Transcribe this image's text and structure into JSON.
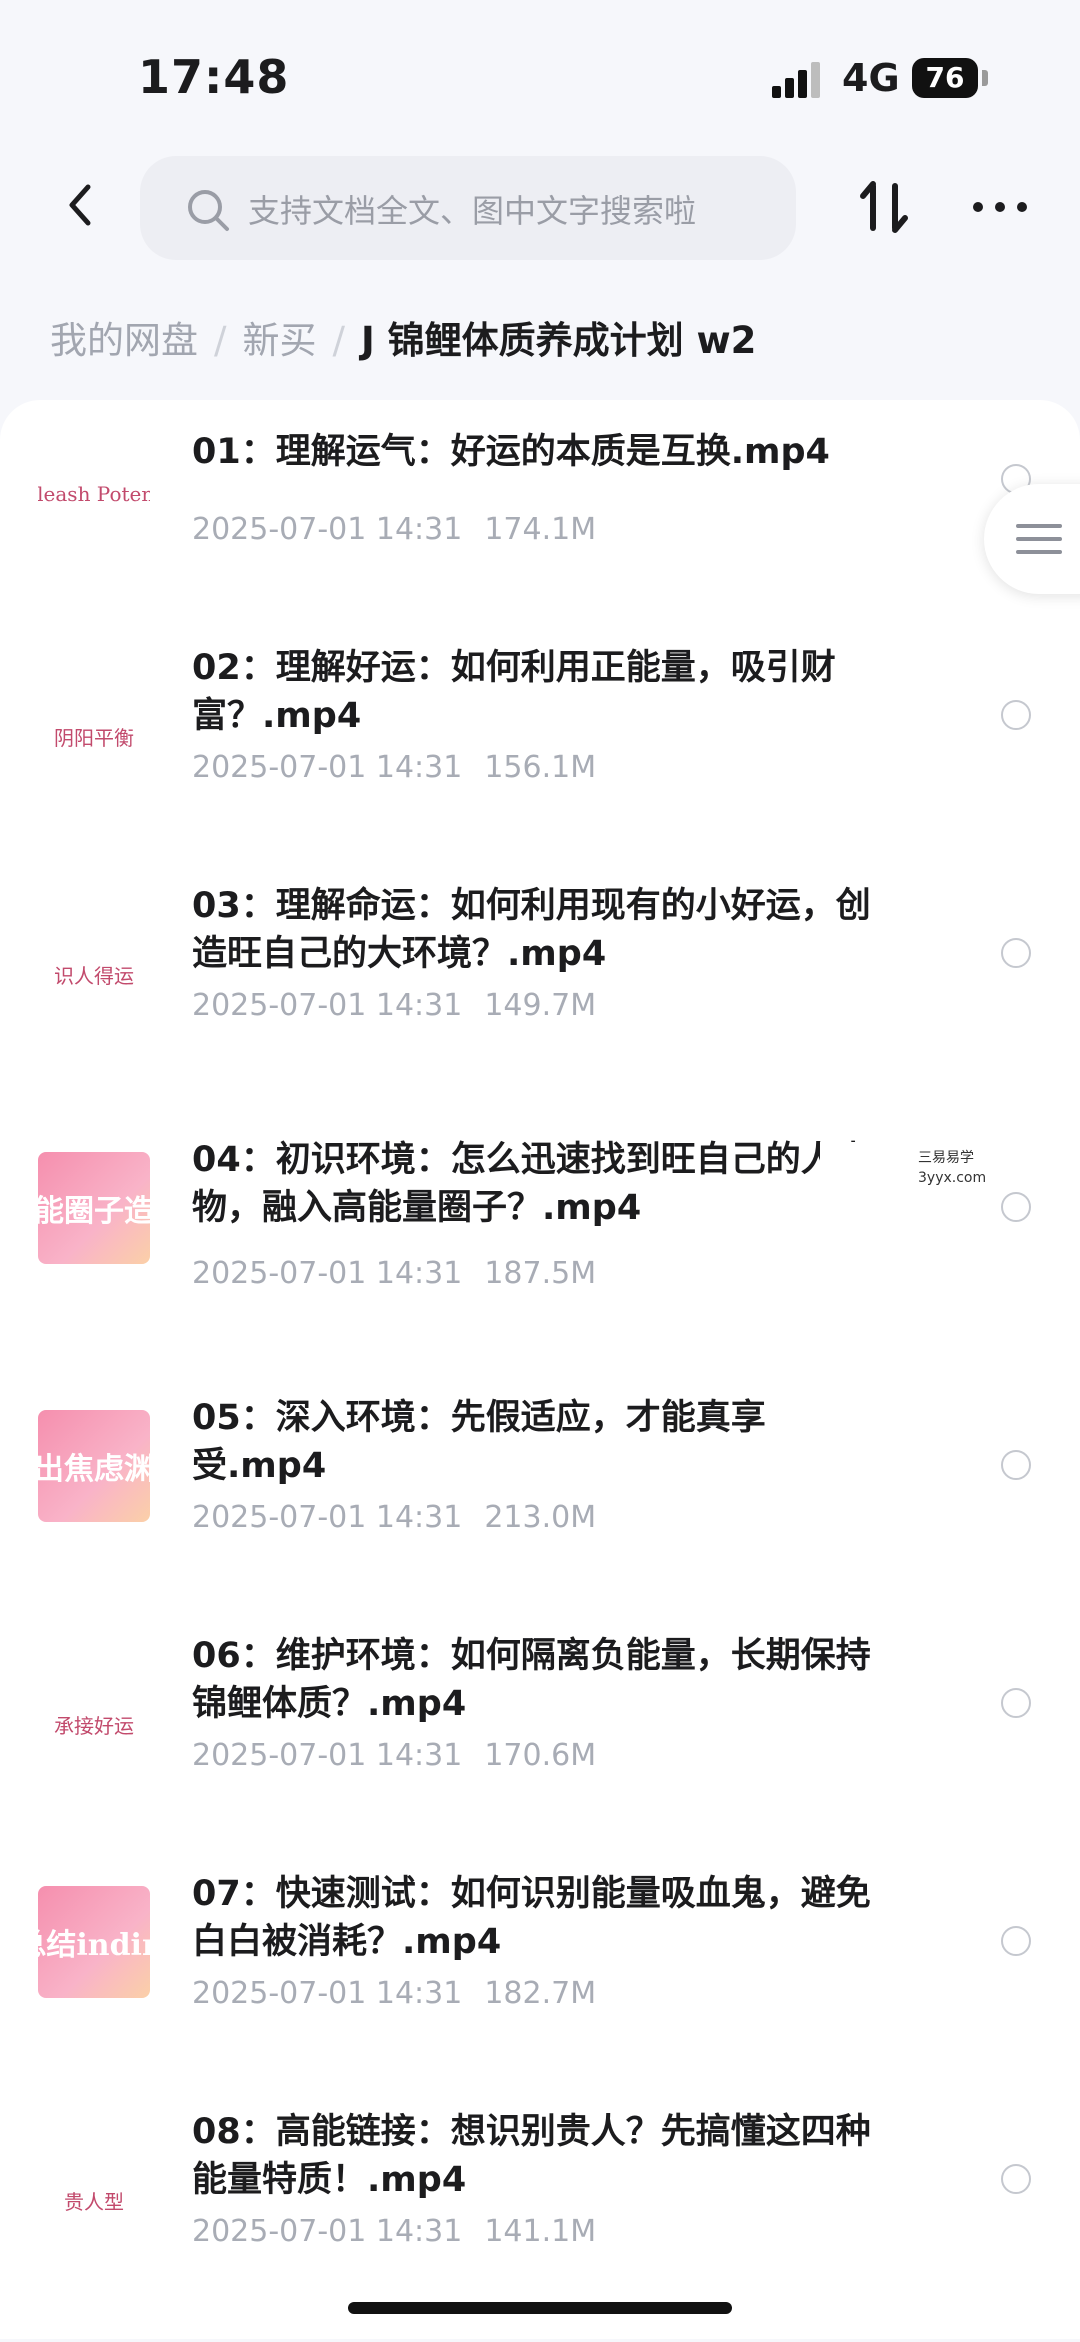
{
  "status_bar": {
    "time": "17:48",
    "network": "4G",
    "battery": "76"
  },
  "search": {
    "placeholder": "支持文档全文、图中文字搜索啦"
  },
  "breadcrumb": {
    "root": "我的网盘",
    "folder": "新买",
    "current": "J 锦鲤体质养成计划 w2",
    "separator": "/"
  },
  "watermark": {
    "line1": "三易易学",
    "line2": "3yyx.com"
  },
  "files": [
    {
      "title": "01：理解运气：好运的本质是互换.mp4",
      "date": "2025-07-01 14:31",
      "size": "174.1M",
      "thumb_text": "Unleash Potentia",
      "thumb_style": "light"
    },
    {
      "title": "02：理解好运：如何利用正能量，吸引财富？.mp4",
      "date": "2025-07-01 14:31",
      "size": "156.1M",
      "thumb_text": "阴阳平衡",
      "thumb_style": "light"
    },
    {
      "title": "03：理解命运：如何利用现有的小好运，创造旺自己的大环境？.mp4",
      "date": "2025-07-01 14:31",
      "size": "149.7M",
      "thumb_text": "识人得运",
      "thumb_style": "light"
    },
    {
      "title": "04：初识环境：怎么迅速找到旺自己的人事物，融入高能量圈子？.mp4",
      "date": "2025-07-01 14:31",
      "size": "187.5M",
      "thumb_text": "能圈子造",
      "thumb_style": "pink"
    },
    {
      "title": "05：深入环境：先假适应，才能真享受.mp4",
      "date": "2025-07-01 14:31",
      "size": "213.0M",
      "thumb_text": "出焦虑渊",
      "thumb_style": "pink"
    },
    {
      "title": "06：维护环境：如何隔离负能量，长期保持锦鲤体质？.mp4",
      "date": "2025-07-01 14:31",
      "size": "170.6M",
      "thumb_text": "承接好运",
      "thumb_style": "light"
    },
    {
      "title": "07：快速测试：如何识别能量吸血鬼，避免白白被消耗？.mp4",
      "date": "2025-07-01 14:31",
      "size": "182.7M",
      "thumb_text": "现总结indings",
      "thumb_style": "pink"
    },
    {
      "title": "08：高能链接：想识别贵人？先搞懂这四种能量特质！.mp4",
      "date": "2025-07-01 14:31",
      "size": "141.1M",
      "thumb_text": "贵人型",
      "thumb_style": "light"
    }
  ]
}
